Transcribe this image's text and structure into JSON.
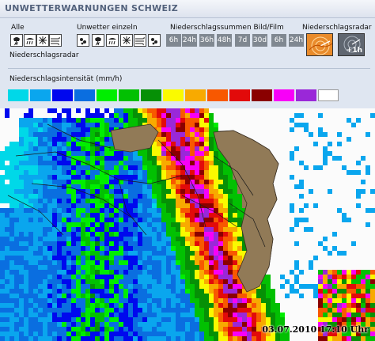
{
  "header": {
    "title": "UNWETTERWARNUNGEN SCHWEIZ"
  },
  "controls": {
    "alle_label": "Alle",
    "unwetter_label": "Unwetter einzeln",
    "summen_label": "Niederschlagssummen Bild/Film",
    "radar_label": "Niederschlagsradar",
    "radar_sub_label": "Niederschlagsradar",
    "warning_icons": [
      "thunderstorm-icon",
      "rain-icon",
      "snow-icon",
      "wind-icon",
      "hail-icon",
      "frost-icon",
      "fog-icon",
      "flood-icon",
      "slippery-road-icon",
      "heat-icon"
    ],
    "bild_buttons": [
      "6h",
      "24h",
      "36h",
      "48h",
      "7d",
      "30d"
    ],
    "film_buttons": [
      "6h",
      "24h"
    ],
    "radar_plus_label": "+1h"
  },
  "legend": {
    "title": "Niederschlagsintensität (mm/h)",
    "colors": [
      "#00d8e8",
      "#0aa6ee",
      "#0008ee",
      "#0a6ee0",
      "#00ee00",
      "#02c002",
      "#069006",
      "#fafa00",
      "#f8aa00",
      "#f85800",
      "#e20a0a",
      "#8a0000",
      "#f800f8",
      "#9a28d8",
      "#ffffff"
    ]
  },
  "map": {
    "timestamp": "03.07.2010 17:10 Uhr",
    "ch_color": "#917a57"
  }
}
